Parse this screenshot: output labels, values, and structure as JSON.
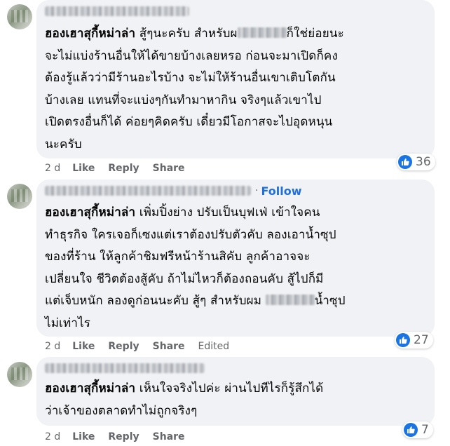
{
  "comments": [
    {
      "author": "ฮองเฮาสุกี้หม่าล่า",
      "lines": [
        "สู้ๆนะครับ สำหรับผ",
        "ก็ใช่ย่อยนะ",
        "จะไม่แบ่งร้านอื่นให้ได้ขายบ้างเลยหรอ ก่อนจะมาเปิดก็คง",
        "ต้องรู้แล้วว่ามีร้านอะไรบ้าง จะไม่ให้ร้านอื่นเขาเติบโตกัน",
        "บ้างเลย แทนที่จะแบ่งๆกันทำมาหากิน จริงๆแล้วเขาไป",
        "เปิดตรงอื่นก็ได้ ค่อยๆคิดครับ เดี๋ยวมีโอกาสจะไปอุดหนุน",
        "นะครับ"
      ],
      "time": "2 d",
      "like_label": "Like",
      "reply_label": "Reply",
      "share_label": "Share",
      "reaction_count": "36"
    },
    {
      "follow_label": "Follow",
      "author": "ฮองเฮาสุกี้หม่าล่า",
      "lines": [
        "เพิ่มปิ้งย่าง ปรับเป็นบุฟเฟ่ เข้าใจคน",
        "ทำธุรกิจ ใครเจอก็เซงแต่เราต้องปรับตัวคับ ลองเอาน้ำซุป",
        "ของที่ร้าน ให้ลูกค้าชิมฟรีหน้าร้านสิคับ ลูกค้าอาจจะ",
        "เปลี่ยนใจ ชีวิตต้องสู้คับ ถ้าไม่ไหวก็ต้องถอนคับ สู้ไปก็มี",
        "แต่เจ็บหนัก ลองดูก่อนนะคับ สู้ๆ สำหรับผม",
        "น้ำซุป",
        "ไม่เท่าไร"
      ],
      "time": "2 d",
      "like_label": "Like",
      "reply_label": "Reply",
      "share_label": "Share",
      "edited_label": "Edited",
      "reaction_count": "27"
    },
    {
      "author": "ฮองเฮาสุกี้หม่าล่า",
      "lines": [
        "เห็นใจจริงไปค่ะ ผ่านไปทีไรก็รู้สึกได้",
        "ว่าเจ้าของตลาดทำไม่ถูกจริงๆ"
      ],
      "time": "2 d",
      "like_label": "Like",
      "reply_label": "Reply",
      "share_label": "Share",
      "reaction_count": "7"
    }
  ],
  "icons": {
    "reaction": "like-thumbs-up-icon"
  },
  "colors": {
    "bubble": "#f0f2f5",
    "link": "#216fdb",
    "meta": "#65676b",
    "like_blue": "#1b74e4"
  }
}
